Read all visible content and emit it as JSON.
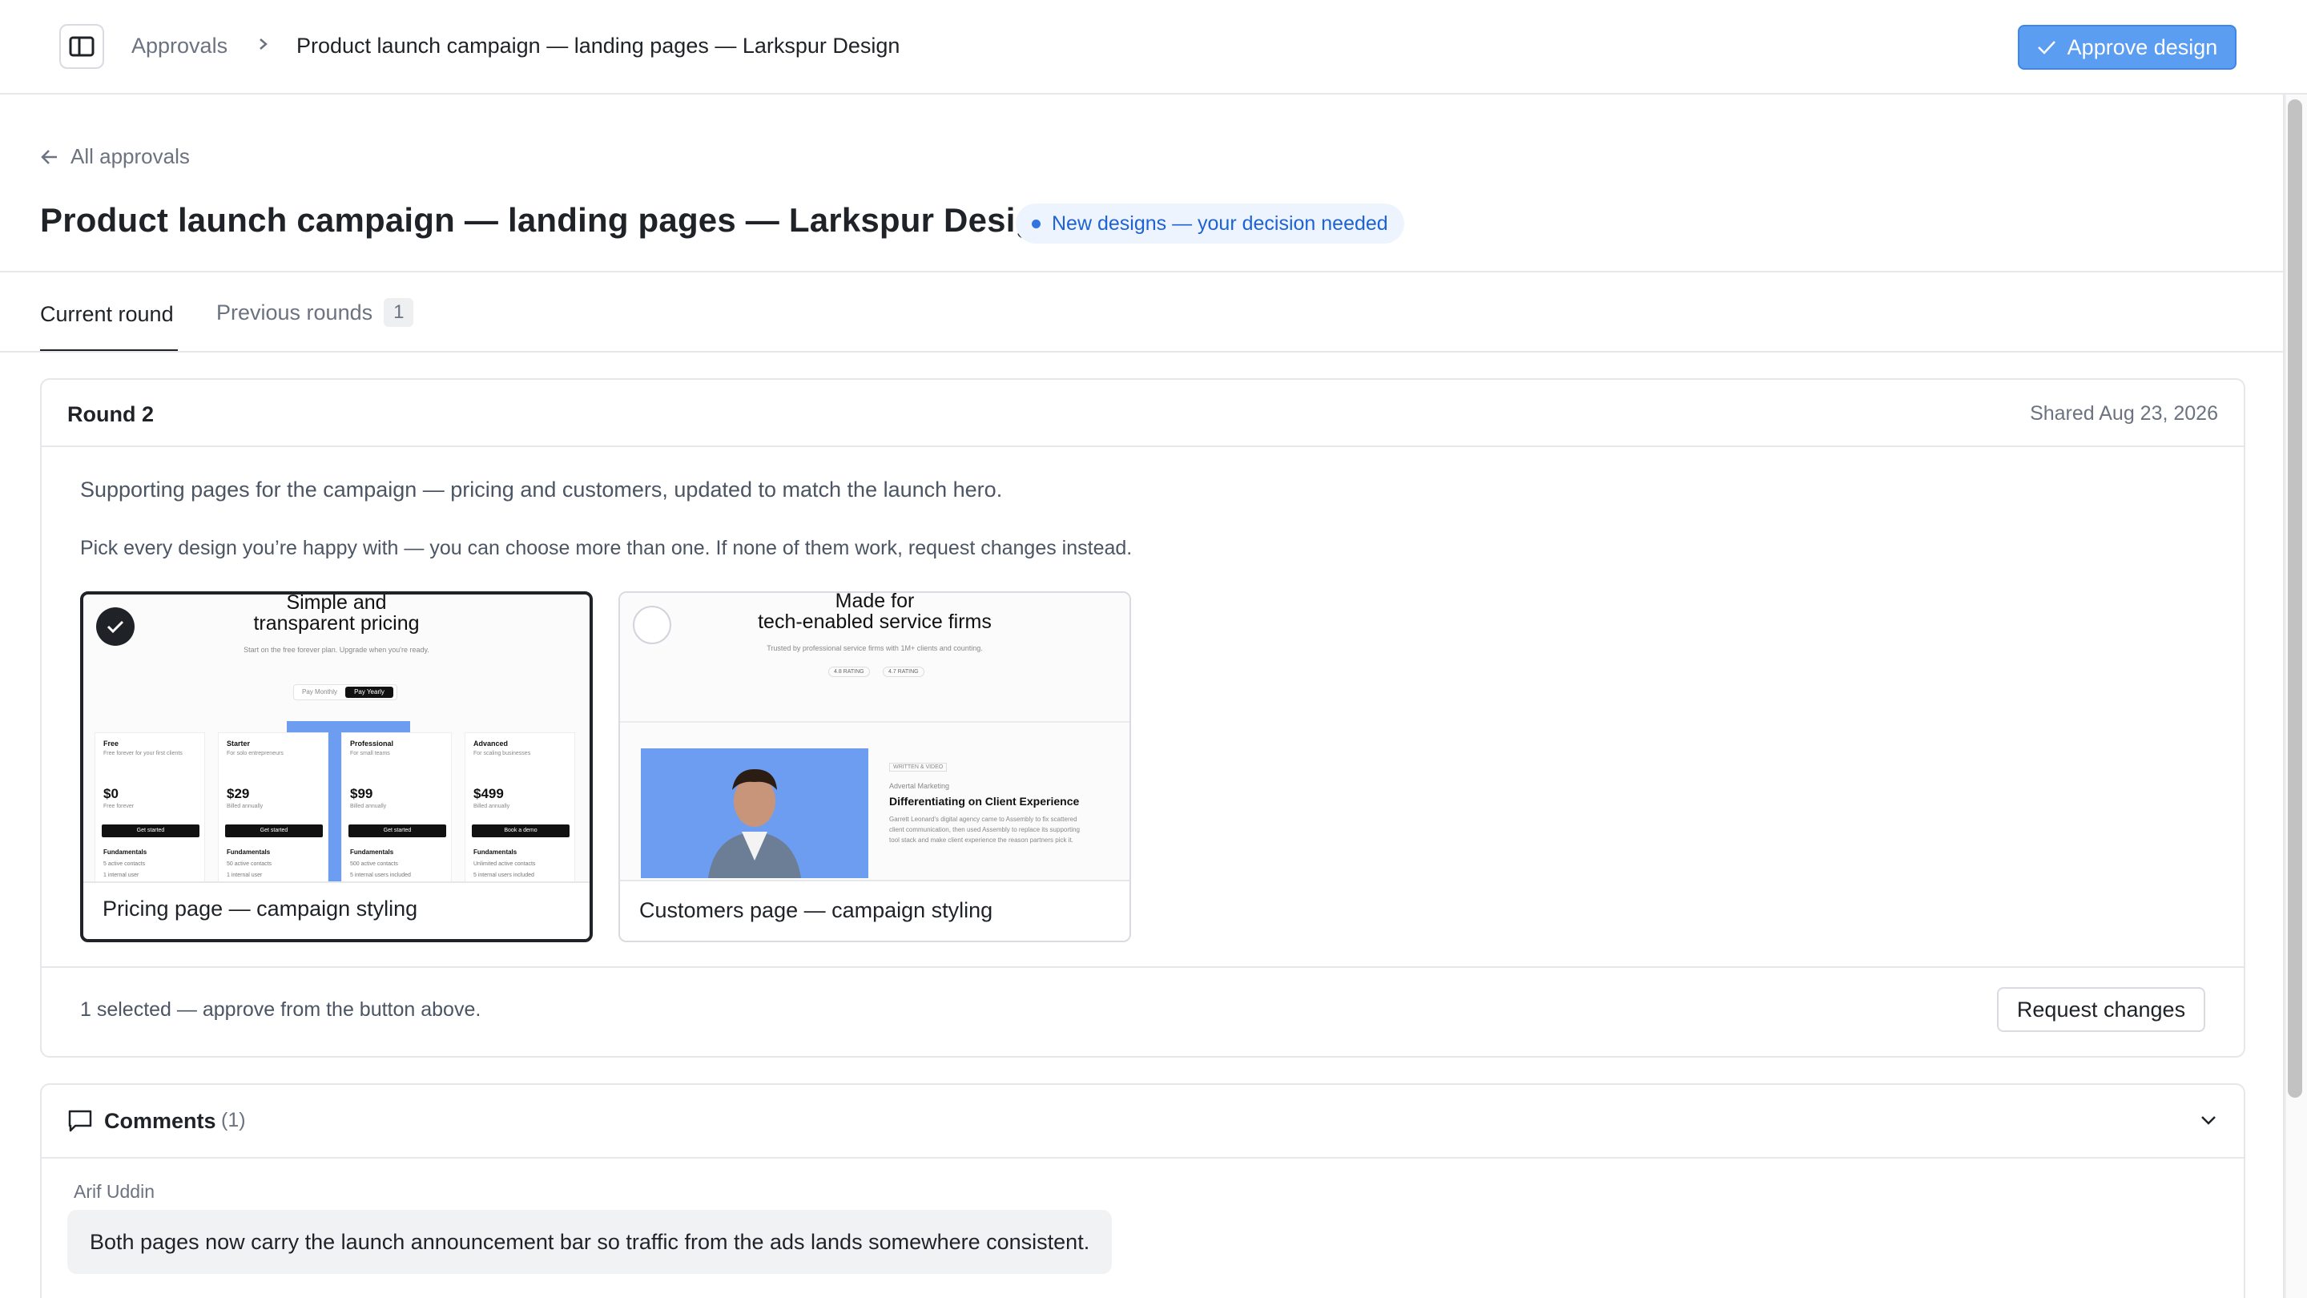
{
  "header": {
    "breadcrumb_root": "Approvals",
    "breadcrumb_current": "Product launch campaign — landing pages — Larkspur Design",
    "approve_label": "Approve design",
    "icons": [
      "sidebar-toggle-icon",
      "chevron-right-icon",
      "check-icon"
    ]
  },
  "page": {
    "back_label": "All approvals",
    "title": "Product launch campaign — landing pages — Larkspur Design",
    "status": "New designs — your decision needed"
  },
  "tabs": [
    {
      "label": "Current round",
      "active": true
    },
    {
      "label": "Previous rounds",
      "count": "1",
      "active": false
    }
  ],
  "round": {
    "title": "Round 2",
    "shared": "Shared Aug 23, 2026",
    "description": "Supporting pages for the campaign — pricing and customers, updated to match the launch hero.",
    "instructions": "Pick every design you’re happy with — you can choose more than one. If none of them work, request changes instead.",
    "designs": [
      {
        "label": "Pricing page — campaign styling",
        "selected": true,
        "thumb": {
          "heading_1": "Simple and",
          "heading_2": "transparent pricing",
          "subline": "Start on the free forever plan. Upgrade when you're ready.",
          "toggle_monthly": "Pay Monthly",
          "toggle_yearly": "Pay Yearly",
          "plans": [
            {
              "name": "Free",
              "desc": "Free forever for your first clients",
              "price": "$0",
              "period": "Free forever",
              "cta": "Get started",
              "section": "Fundamentals",
              "f1": "5 active contacts",
              "f2": "1 internal user"
            },
            {
              "name": "Starter",
              "desc": "For solo entrepreneurs",
              "price": "$29",
              "period": "Billed annually",
              "cta": "Get started",
              "section": "Fundamentals",
              "f1": "50 active contacts",
              "f2": "1 internal user"
            },
            {
              "name": "Professional",
              "desc": "For small teams",
              "price": "$99",
              "period": "Billed annually",
              "cta": "Get started",
              "section": "Fundamentals",
              "f1": "500 active contacts",
              "f2": "5 internal users included"
            },
            {
              "name": "Advanced",
              "desc": "For scaling businesses",
              "price": "$499",
              "period": "Billed annually",
              "cta": "Book a demo",
              "section": "Fundamentals",
              "f1": "Unlimited active contacts",
              "f2": "5 internal users included"
            }
          ]
        }
      },
      {
        "label": "Customers page — campaign styling",
        "selected": false,
        "thumb": {
          "heading_1": "Made for",
          "heading_2": "tech-enabled service firms",
          "subline": "Trusted by professional service firms with 1M+ clients and counting.",
          "rating_1": "4.8 RATING",
          "rating_2": "4.7 RATING",
          "tag": "WRITTEN & VIDEO",
          "company": "Advertal Marketing",
          "story_title": "Differentiating on Client Experience",
          "story_body": "Garrett Leonard's digital agency came to Assembly to fix scattered client communication, then used Assembly to replace its supporting tool stack and make client experience the reason partners pick it."
        }
      }
    ],
    "selected_count": "1 selected — approve from the button above.",
    "request_label": "Request changes"
  },
  "comments": {
    "title": "Comments",
    "count": "(1)",
    "items": [
      {
        "author": "Arif Uddin",
        "text": "Both pages now carry the launch announcement bar so traffic from the ads lands somewhere consistent."
      }
    ]
  },
  "colors": {
    "accent": "#5b9df0",
    "badge_bg": "#eef4fd",
    "badge_text": "#1d63d6",
    "selected_border": "#1f2328"
  }
}
